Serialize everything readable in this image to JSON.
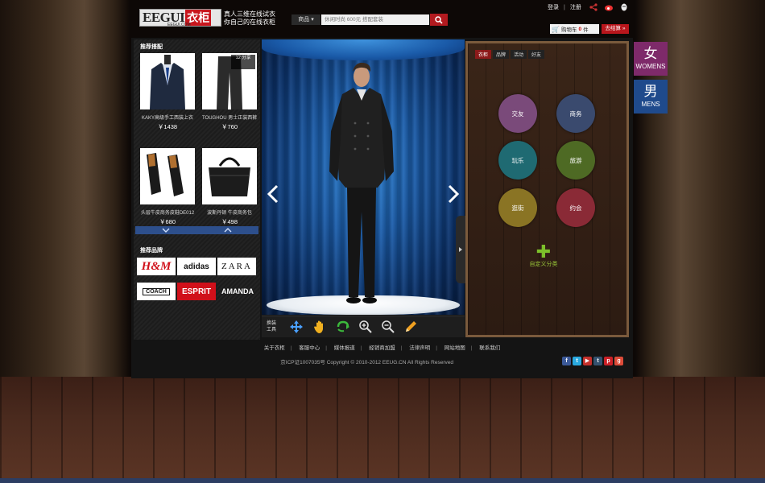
{
  "header": {
    "logo_text": "EEGUI",
    "logo_cn": "衣柜",
    "logo_sub": "EEGUI.COM",
    "slogan_line1": "真人三维在线试衣",
    "slogan_line2": "你自己的在线衣柜",
    "search_category": "商品 ▾",
    "search_placeholder": "休闲时尚 600元 搭配套装",
    "login": "登录",
    "register": "注册",
    "cart_label": "购物车",
    "cart_count": "0",
    "cart_unit": "件",
    "checkout": "去结算 »"
  },
  "left": {
    "recommend_title": "推荐搭配",
    "products": [
      {
        "name": "KAKY高级手工西装上衣",
        "price": "￥1438"
      },
      {
        "name": "TOUGHOU 男士正装西裤",
        "price": "￥760"
      },
      {
        "name": "头层牛皮商务皮鞋DE012",
        "price": "￥680"
      },
      {
        "name": "波斯丹顿 牛皮商务包",
        "price": "￥498"
      }
    ],
    "share_count": "12",
    "share_label": "分享",
    "brands_title": "推荐品牌",
    "brands": [
      "H&M",
      "adidas",
      "ZARA",
      "COACH",
      "ESPRIT",
      "AMANDA"
    ]
  },
  "toolbar": {
    "label_line1": "换装",
    "label_line2": "工具"
  },
  "right": {
    "tabs": [
      "衣柜",
      "品牌",
      "活动",
      "好友"
    ],
    "categories": [
      {
        "label": "交友",
        "color": "#7a4a7a"
      },
      {
        "label": "商务",
        "color": "#3a4a6e"
      },
      {
        "label": "玩乐",
        "color": "#1f6a72"
      },
      {
        "label": "旅游",
        "color": "#4e6a24"
      },
      {
        "label": "逛街",
        "color": "#8a7424"
      },
      {
        "label": "约会",
        "color": "#8a2a36"
      }
    ],
    "custom_label": "自定义分类"
  },
  "gender": {
    "women_cn": "女",
    "women_en": "WOMENS",
    "men_cn": "男",
    "men_en": "MENS",
    "women_color": "#7e2a6a",
    "men_color": "#1f4a8c"
  },
  "footer": {
    "links": [
      "关于衣柜",
      "客服中心",
      "媒体报道",
      "经销商加盟",
      "法律声明",
      "网站地图",
      "联系我们"
    ],
    "copyright": "京ICP证1007035号 Copyright © 2010-2012 EEUG.CN All Rights Reserved",
    "socials": [
      "facebook-icon",
      "twitter-icon",
      "youtube-icon",
      "tumblr-icon",
      "pinterest-icon",
      "googleplus-icon"
    ]
  }
}
